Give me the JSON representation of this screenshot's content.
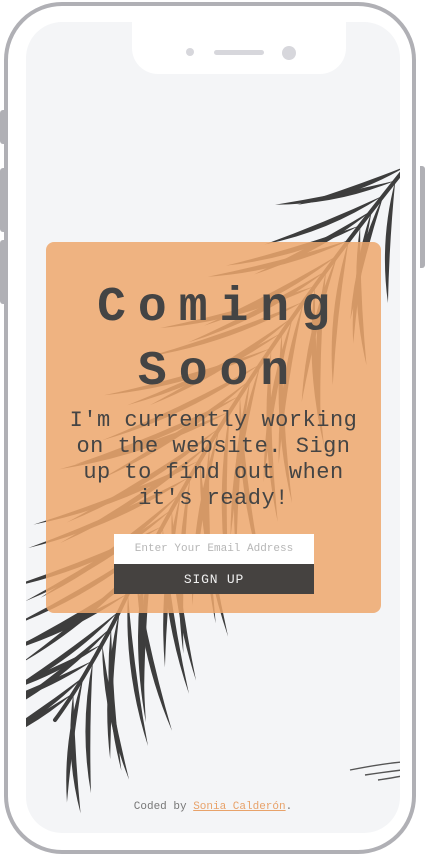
{
  "colors": {
    "card": "#eea86e",
    "button": "#454240",
    "text": "#444444",
    "link": "#e8a26a",
    "frame": "#b0b0b5",
    "screen": "#f4f5f7"
  },
  "hero": {
    "title_line1": "Coming",
    "title_line2": "Soon",
    "subtitle": "I'm currently working on the website. Sign up to find out when it's ready!"
  },
  "form": {
    "email_placeholder": "Enter Your Email Address",
    "email_value": "",
    "submit_label": "SIGN UP"
  },
  "footer": {
    "prefix": "Coded by",
    "author": "Sonia Calderón",
    "suffix": "."
  },
  "decor": {
    "background_icon": "palm-leaf-icon",
    "device": "phone-frame"
  }
}
